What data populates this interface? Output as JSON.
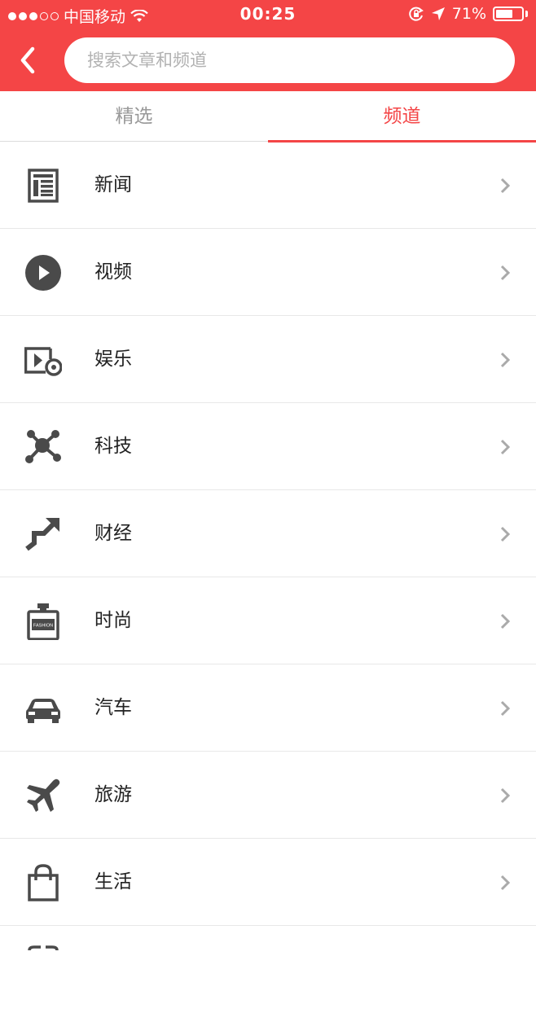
{
  "status_bar": {
    "carrier": "中国移动",
    "time": "00:25",
    "battery": "71%",
    "battery_level": 0.71
  },
  "header": {
    "back_icon": "chevron-left-icon",
    "search_placeholder": "搜索文章和频道"
  },
  "tabs": [
    {
      "label": "精选",
      "active": false
    },
    {
      "label": "频道",
      "active": true
    }
  ],
  "channels": [
    {
      "label": "新闻",
      "icon": "newspaper-icon"
    },
    {
      "label": "视频",
      "icon": "play-icon"
    },
    {
      "label": "娱乐",
      "icon": "movie-icon"
    },
    {
      "label": "科技",
      "icon": "molecule-icon"
    },
    {
      "label": "财经",
      "icon": "trend-up-icon"
    },
    {
      "label": "时尚",
      "icon": "perfume-icon"
    },
    {
      "label": "汽车",
      "icon": "car-icon"
    },
    {
      "label": "旅游",
      "icon": "airplane-icon"
    },
    {
      "label": "生活",
      "icon": "shopping-bag-icon"
    }
  ],
  "fashion_icon_text": "FASHION",
  "colors": {
    "accent": "#f44546",
    "icon": "#4a4a4a"
  }
}
